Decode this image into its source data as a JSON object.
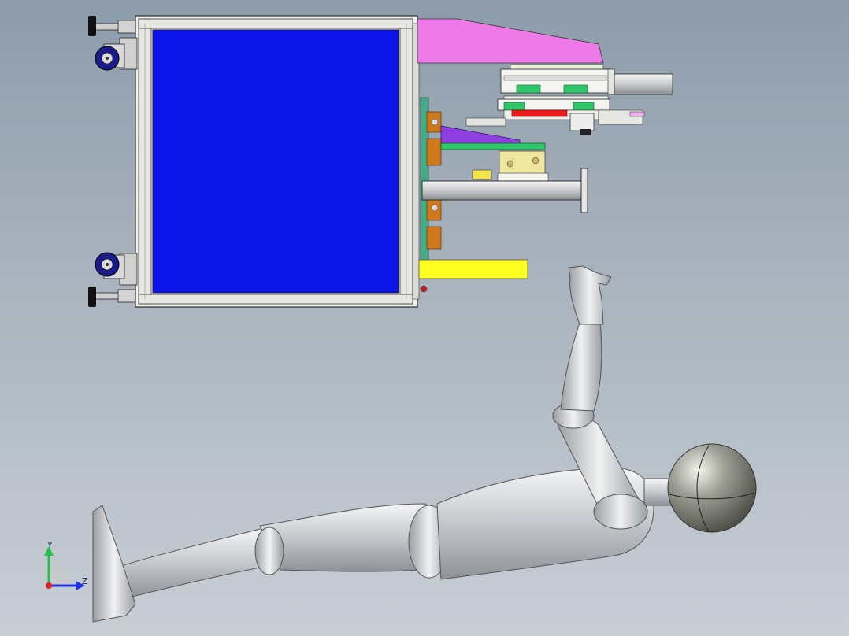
{
  "viewport": {
    "background_top": "#8d9cab",
    "background_bottom": "#c8ced5"
  },
  "model": {
    "frame_color": "#f2f3ee",
    "panel_color": "#0a14e6",
    "pink_plate_color": "#ee7ae8",
    "yellow_block_color": "#ffff22",
    "purple_plate_color": "#9040e0",
    "orange_block_color": "#d0781c",
    "green_plate_color": "#2ec86a",
    "red_cylinder_color": "#ee1a1a",
    "mannequin_color": "#c9ccd0"
  },
  "triad": {
    "y_label": "Y",
    "z_label": "Z",
    "y_color": "#22c24a",
    "z_color": "#2233dd",
    "x_color": "#dd2222"
  }
}
